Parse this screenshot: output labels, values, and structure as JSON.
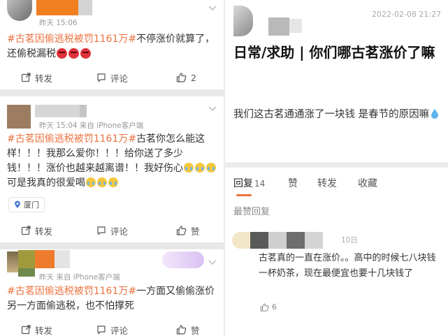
{
  "left_feed": {
    "posts": [
      {
        "time": "昨天 15:06",
        "text_segments": [
          {
            "type": "tag",
            "text": "#古茗因偷逃税被罚1161万#"
          },
          {
            "type": "text",
            "text": "不停涨价就算了，还偷税漏税"
          }
        ],
        "actions": {
          "repost": "转发",
          "comment": "评论",
          "like": "2"
        }
      },
      {
        "time": "昨天 15:04 来自 iPhone客户端",
        "text_segments": [
          {
            "type": "tag",
            "text": "#古茗因偷逃税被罚1161万#"
          },
          {
            "type": "text",
            "text": "古茗你怎么能这样！！！我那么爱你！！！给你送了多少钱！！！涨价也越来越离谱！！我好伤心"
          },
          {
            "type": "text",
            "text": "可是我真的很爱喝"
          }
        ],
        "location": "厦门",
        "actions": {
          "repost": "转发",
          "comment": "评论",
          "like": "赞"
        }
      },
      {
        "time": "昨天 来自 iPhone客户端",
        "text_segments": [
          {
            "type": "tag",
            "text": "#古茗因偷逃税被罚1161万#"
          },
          {
            "type": "text",
            "text": "一方面又偷偷涨价另一方面偷逃税，也不怕撑死"
          }
        ],
        "actions": {
          "repost": "转发",
          "comment": "评论",
          "like": "赞"
        }
      }
    ]
  },
  "right_post": {
    "timestamp": "2022-02-08 21:27",
    "title": "日常/求助 | 你们哪古茗涨价了嘛",
    "body": "我们这古茗通通涨了一块钱  是春节的原因嘛",
    "tabs": [
      {
        "label": "回复",
        "count": "14",
        "active": true
      },
      {
        "label": "赞",
        "count": "",
        "active": false
      },
      {
        "label": "转发",
        "count": "",
        "active": false
      },
      {
        "label": "收藏",
        "count": "",
        "active": false
      }
    ],
    "section_label": "最赞回复",
    "reply": {
      "date": "10日",
      "text": "古茗真的一直在涨价。。高中的时候七八块钱一杯奶茶，现在最便宜也要十几块钱了",
      "likes": "6"
    }
  },
  "colors": {
    "accent": "#eb7340",
    "text": "#333333",
    "muted": "#999999",
    "tab_active": "#222222"
  }
}
